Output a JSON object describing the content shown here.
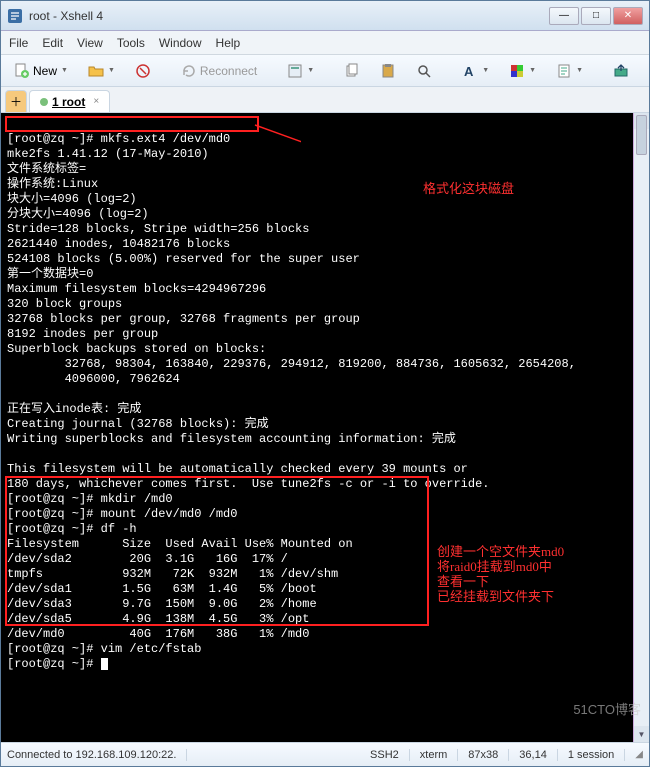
{
  "window": {
    "title": "root - Xshell 4"
  },
  "menu": {
    "file": "File",
    "edit": "Edit",
    "view": "View",
    "tools": "Tools",
    "window": "Window",
    "help": "Help"
  },
  "toolbar": {
    "new": "New",
    "reconnect": "Reconnect"
  },
  "tabs": {
    "main": "1 root"
  },
  "terminal": {
    "prompt": "[root@zq ~]#",
    "cmd_mkfs": "mkfs.ext4 /dev/md0",
    "l1": "mke2fs 1.41.12 (17-May-2010)",
    "l2": "文件系统标签=",
    "l3": "操作系统:Linux",
    "l4": "块大小=4096 (log=2)",
    "l5": "分块大小=4096 (log=2)",
    "l6": "Stride=128 blocks, Stripe width=256 blocks",
    "l7": "2621440 inodes, 10482176 blocks",
    "l8": "524108 blocks (5.00%) reserved for the super user",
    "l9": "第一个数据块=0",
    "l10": "Maximum filesystem blocks=4294967296",
    "l11": "320 block groups",
    "l12": "32768 blocks per group, 32768 fragments per group",
    "l13": "8192 inodes per group",
    "l14": "Superblock backups stored on blocks:",
    "l15": "        32768, 98304, 163840, 229376, 294912, 819200, 884736, 1605632, 2654208,",
    "l16": "        4096000, 7962624",
    "l17": "",
    "l18": "正在写入inode表: 完成",
    "l19": "Creating journal (32768 blocks): 完成",
    "l20": "Writing superblocks and filesystem accounting information: 完成",
    "l21": "",
    "l22": "This filesystem will be automatically checked every 39 mounts or",
    "l23": "180 days, whichever comes first.  Use tune2fs -c or -i to override.",
    "cmd_mkdir": "mkdir /md0",
    "cmd_mount": "mount /dev/md0 /md0",
    "cmd_df": "df -h",
    "dfh": "Filesystem      Size  Used Avail Use% Mounted on",
    "df1": "/dev/sda2        20G  3.1G   16G  17% /",
    "df2": "tmpfs           932M   72K  932M   1% /dev/shm",
    "df3": "/dev/sda1       1.5G   63M  1.4G   5% /boot",
    "df4": "/dev/sda3       9.7G  150M  9.0G   2% /home",
    "df5": "/dev/sda5       4.9G  138M  4.5G   3% /opt",
    "df6": "/dev/md0         40G  176M   38G   1% /md0",
    "cmd_vim": "vim /etc/fstab"
  },
  "annotations": {
    "a1": "格式化这块磁盘",
    "a2": "创建一个空文件夹md0",
    "a3": "将raid0挂载到md0中",
    "a4": "查看一下",
    "a5": "已经挂载到文件夹下"
  },
  "status": {
    "conn": "Connected to 192.168.109.120:22.",
    "proto": "SSH2",
    "term": "xterm",
    "size": "87x38",
    "pos": "36,14",
    "sess": "1 session"
  },
  "watermark": "51CTO博客"
}
